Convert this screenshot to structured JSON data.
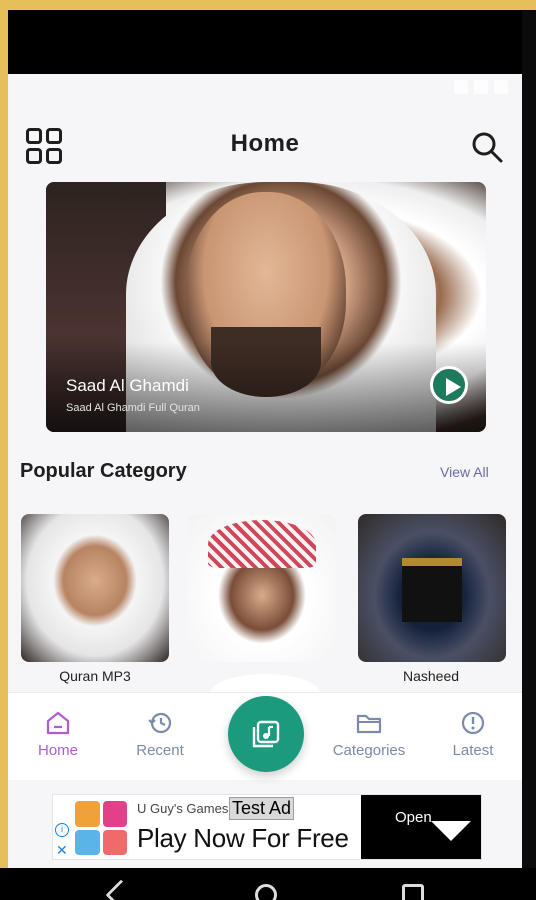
{
  "header": {
    "title": "Home"
  },
  "hero": {
    "title": "Saad Al Ghamdi",
    "subtitle": "Saad Al Ghamdi Full Quran"
  },
  "popular": {
    "title": "Popular Category",
    "view_all": "View All",
    "cards": [
      {
        "label": "Quran MP3"
      },
      {
        "label": ""
      },
      {
        "label": "Nasheed"
      }
    ]
  },
  "bottom_nav": {
    "items": [
      {
        "label": "Home",
        "icon": "home-icon",
        "active": true
      },
      {
        "label": "Recent",
        "icon": "history-icon"
      },
      {
        "label": "Categories",
        "icon": "folder-icon"
      },
      {
        "label": "Latest",
        "icon": "alert-circle-icon"
      }
    ],
    "center_icon": "music-library-icon"
  },
  "ad": {
    "advertiser": "U Guy's Games",
    "tag": "Test Ad",
    "headline": "Play Now For Free",
    "cta": "Open"
  },
  "colors": {
    "accent": "#b25ad6",
    "fab": "#1c9a7e",
    "text": "#1e1e1e",
    "nav": "#7b8aa6"
  }
}
